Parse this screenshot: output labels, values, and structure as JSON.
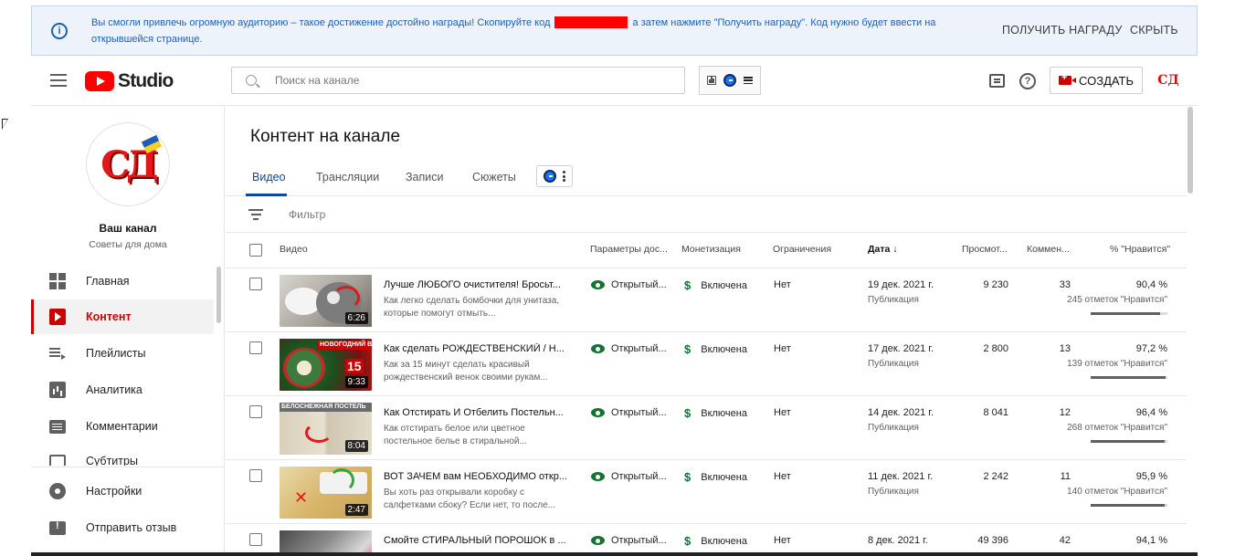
{
  "banner": {
    "message_before": "Вы смогли привлечь огромную аудиторию – такое достижение достойно награды! Скопируйте код",
    "message_after": "а затем нажмите \"Получить награду\". Код нужно будет ввести на открывшейся странице.",
    "get_reward_label": "ПОЛУЧИТЬ НАГРАДУ",
    "hide_label": "СКРЫТЬ",
    "info_icon": "i"
  },
  "header": {
    "logo_text": "Studio",
    "search_placeholder": "Поиск на канале",
    "create_label": "СОЗДАТЬ",
    "help_glyph": "?",
    "avatar_text": "СД"
  },
  "channel": {
    "avatar_text": "СД",
    "name": "Ваш канал",
    "subtitle": "Советы для дома"
  },
  "sidebar": {
    "items": [
      {
        "label": "Главная",
        "icon": "dashboard-icon"
      },
      {
        "label": "Контент",
        "icon": "content-icon",
        "active": true
      },
      {
        "label": "Плейлисты",
        "icon": "playlists-icon"
      },
      {
        "label": "Аналитика",
        "icon": "analytics-icon"
      },
      {
        "label": "Комментарии",
        "icon": "comments-icon"
      },
      {
        "label": "Субтитры",
        "icon": "subtitles-icon"
      }
    ],
    "bottom_items": [
      {
        "label": "Настройки",
        "icon": "settings-icon"
      },
      {
        "label": "Отправить отзыв",
        "icon": "feedback-icon"
      }
    ]
  },
  "main": {
    "title": "Контент на канале",
    "tabs": [
      {
        "label": "Видео",
        "active": true
      },
      {
        "label": "Трансляции"
      },
      {
        "label": "Записи"
      },
      {
        "label": "Сюжеты"
      }
    ],
    "filter_label": "Фильтр",
    "columns": {
      "video": "Видео",
      "visibility": "Параметры дос...",
      "monetization": "Монетизация",
      "restrictions": "Ограничения",
      "date": "Дата",
      "sort_arrow": "↓",
      "views": "Просмот...",
      "comments": "Коммен...",
      "likes": "% \"Нравится\""
    }
  },
  "videos": [
    {
      "title": "Лучше ЛЮБОГО очистителя! Бросьт...",
      "desc": "Как легко сделать бомбочки для унитаза, которые помогут отмыть...",
      "duration": "6:26",
      "visibility": "Открытый...",
      "monetization": "Включена",
      "restrictions": "Нет",
      "date": "19 дек. 2021 г.",
      "date_sub": "Публикация",
      "views": "9 230",
      "comments": "33",
      "likes_pct": "90,4 %",
      "likes_sub": "245 отметок \"Нравится\"",
      "likes_fraction": 0.904
    },
    {
      "title": "Как сделать РОЖДЕСТВЕНСКИЙ / Н...",
      "desc": "Как за 15 минут сделать красивый рождественский венок своими рукам...",
      "duration": "9:33",
      "thumb_caption": "НОВОГОДНИЙ ВЕНОК",
      "visibility": "Открытый...",
      "monetization": "Включена",
      "restrictions": "Нет",
      "date": "17 дек. 2021 г.",
      "date_sub": "Публикация",
      "views": "2 800",
      "comments": "13",
      "likes_pct": "97,2 %",
      "likes_sub": "139 отметок \"Нравится\"",
      "likes_fraction": 0.972
    },
    {
      "title": "Как Отстирать И Отбелить Постельн...",
      "desc": "Как отстирать белое или цветное постельное белье в стиральной...",
      "duration": "8:04",
      "thumb_caption": "БЕЛОСНЕЖНАЯ ПОСТЕЛЬ",
      "visibility": "Открытый...",
      "monetization": "Включена",
      "restrictions": "Нет",
      "date": "14 дек. 2021 г.",
      "date_sub": "Публикация",
      "views": "8 041",
      "comments": "12",
      "likes_pct": "96,4 %",
      "likes_sub": "268 отметок \"Нравится\"",
      "likes_fraction": 0.964
    },
    {
      "title": "ВОТ ЗАЧЕМ вам НЕОБХОДИМО откр...",
      "desc": "Вы хоть раз открывали коробку с салфетками сбоку? Если нет, то после...",
      "duration": "2:47",
      "visibility": "Открытый...",
      "monetization": "Включена",
      "restrictions": "Нет",
      "date": "11 дек. 2021 г.",
      "date_sub": "Публикация",
      "views": "2 242",
      "comments": "11",
      "likes_pct": "95,9 %",
      "likes_sub": "140 отметок \"Нравится\"",
      "likes_fraction": 0.959
    },
    {
      "title": "Смойте СТИРАЛЬНЫЙ ПОРОШОК в ...",
      "desc": "",
      "duration": "",
      "visibility": "Открытый...",
      "monetization": "Включена",
      "restrictions": "Нет",
      "date": "8 дек. 2021 г.",
      "date_sub": "",
      "views": "49 396",
      "comments": "42",
      "likes_pct": "94,1 %",
      "likes_sub": "",
      "likes_fraction": 0.941
    }
  ],
  "colors": {
    "accent_red": "#cc0000",
    "tab_blue": "#0d47a1",
    "banner_text": "#1a5fb4",
    "public_green": "#137333"
  }
}
